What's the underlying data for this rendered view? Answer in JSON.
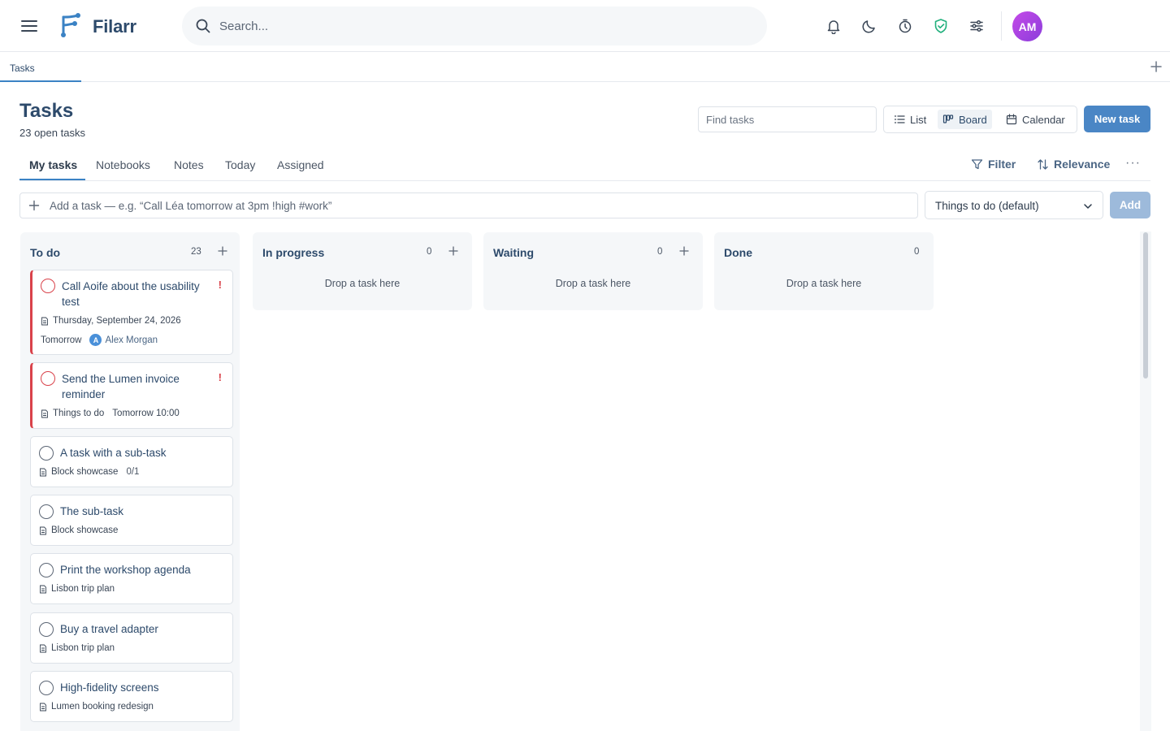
{
  "app": {
    "name": "Filarr",
    "search_placeholder": "Search...",
    "user_initials": "AM",
    "accent_color": "#4a86c5",
    "icons": [
      "menu-icon",
      "logo-icon",
      "search-icon",
      "bell-icon",
      "moon-icon",
      "timer-icon",
      "shield-check-icon",
      "sliders-icon"
    ]
  },
  "doc_tabs": [
    {
      "label": "Tasks"
    }
  ],
  "header": {
    "title": "Tasks",
    "subtitle": "23 open tasks",
    "find_placeholder": "Find tasks",
    "views": [
      {
        "label": "List"
      },
      {
        "label": "Board"
      },
      {
        "label": "Calendar"
      }
    ],
    "active_view": "Board",
    "new_task_label": "New task"
  },
  "subtabs": [
    {
      "label": "My tasks"
    },
    {
      "label": "Notebooks"
    },
    {
      "label": "Notes"
    },
    {
      "label": "Today"
    },
    {
      "label": "Assigned"
    }
  ],
  "toolbar": {
    "filter_label": "Filter",
    "sort_label": "Relevance",
    "more_label": "···"
  },
  "quick_add": {
    "placeholder": "Add a task — e.g. “Call Léa tomorrow at 3pm !high #work”",
    "list_selected": "Things to do (default)",
    "add_label": "Add"
  },
  "board": {
    "columns": [
      {
        "title": "To do",
        "count": "23"
      },
      {
        "title": "In progress",
        "count": "0",
        "empty_text": "Drop a task here"
      },
      {
        "title": "Waiting",
        "count": "0",
        "empty_text": "Drop a task here"
      },
      {
        "title": "Done",
        "count": "0",
        "empty_text": "Drop a task here"
      }
    ],
    "cards": [
      {
        "title": "Call Aoife about the usability test",
        "priority": "!",
        "date": "Thursday, September 24, 2026",
        "due": "Tomorrow",
        "assignee_initial": "A",
        "assignee": "Alex Morgan"
      },
      {
        "title": "Send the Lumen invoice reminder",
        "priority": "!",
        "list": "Things to do",
        "due": "Tomorrow 10:00"
      },
      {
        "title": "A task with a sub-task",
        "list": "Block showcase",
        "subtasks": "0/1"
      },
      {
        "title": "The sub-task",
        "list": "Block showcase"
      },
      {
        "title": "Print the workshop agenda",
        "list": "Lisbon trip plan"
      },
      {
        "title": "Buy a travel adapter",
        "list": "Lisbon trip plan"
      },
      {
        "title": "High-fidelity screens",
        "list": "Lumen booking redesign"
      }
    ]
  }
}
